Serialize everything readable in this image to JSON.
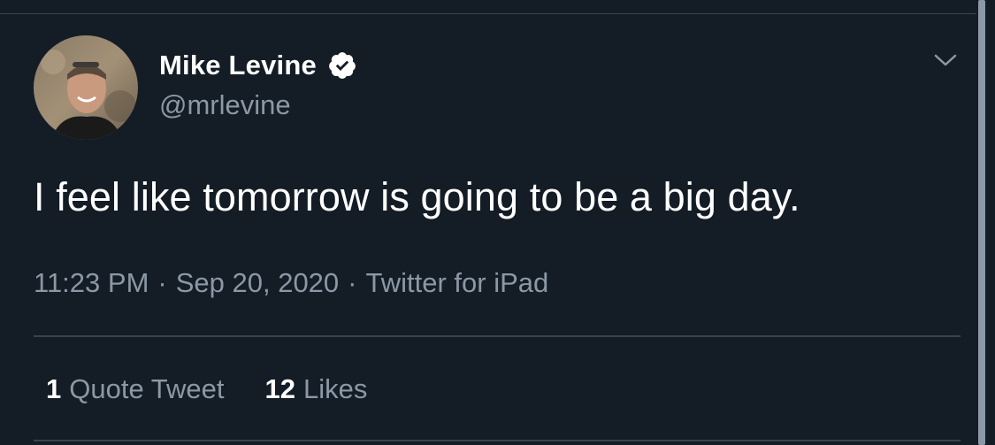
{
  "tweet": {
    "display_name": "Mike Levine",
    "handle": "@mrlevine",
    "text": "I feel like tomorrow is going to be a big day.",
    "time": "11:23 PM",
    "date": "Sep 20, 2020",
    "source": "Twitter for iPad",
    "separator": "·",
    "verified": true
  },
  "stats": {
    "quote_tweets_count": "1",
    "quote_tweets_label": "Quote Tweet",
    "likes_count": "12",
    "likes_label": "Likes"
  },
  "icons": {
    "verified": "verified-badge-icon",
    "caret": "chevron-down-icon"
  },
  "colors": {
    "background": "#141d26",
    "secondary_text": "#8b98a5",
    "divider": "#38444d"
  }
}
